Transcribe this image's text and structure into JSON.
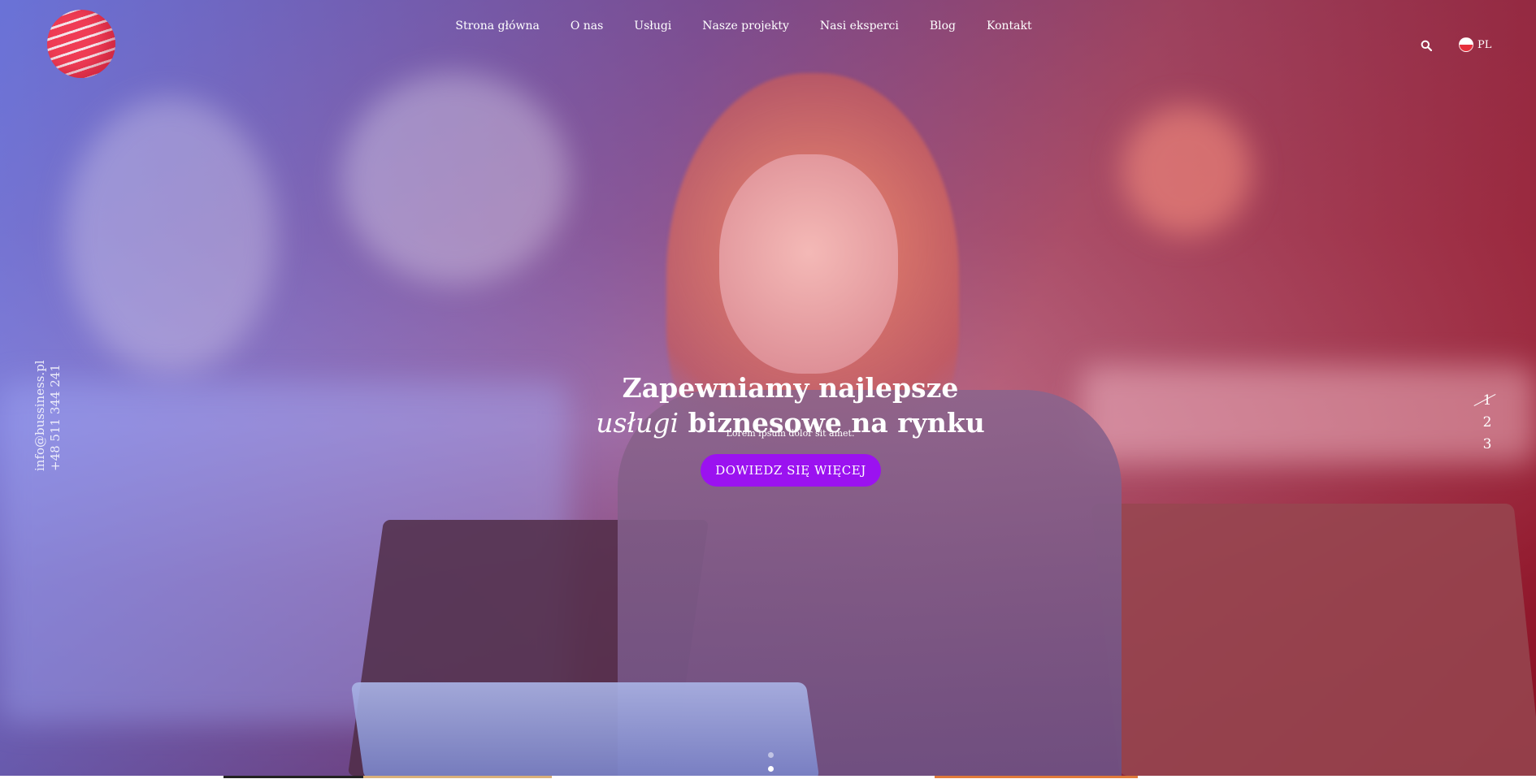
{
  "nav": {
    "items": [
      "Strona główna",
      "O nas",
      "Usługi",
      "Nasze projekty",
      "Nasi eksperci",
      "Blog",
      "Kontakt"
    ]
  },
  "header": {
    "language": "PL"
  },
  "contact": {
    "email": "info@bussiness.pl",
    "phone": "+48 511 344 241"
  },
  "hero": {
    "title_line1": "Zapewniamy najlepsze",
    "title_italic": "usługi",
    "title_line2_rest": " biznesowe na rynku",
    "subtitle": "Lorem ipsum dolor sit amet.",
    "cta_label": "DOWIEDZ SIĘ WIĘCEJ"
  },
  "slider": {
    "numbers": [
      "1",
      "2",
      "3"
    ],
    "active_index": 0
  },
  "colors": {
    "accent": "#9b12f0",
    "logo_red": "#ef3c55"
  },
  "icons": {
    "search": "search-icon",
    "flag": "poland-flag-icon",
    "logo": "globe-logo-icon"
  }
}
